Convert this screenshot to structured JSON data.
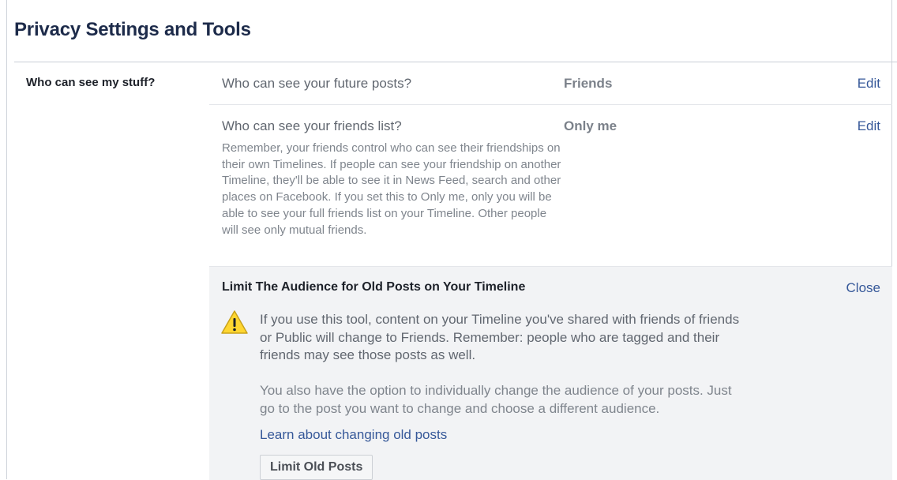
{
  "page": {
    "title": "Privacy Settings and Tools"
  },
  "section": {
    "label": "Who can see my stuff?"
  },
  "settings": [
    {
      "question": "Who can see your future posts?",
      "value": "Friends",
      "action": "Edit"
    },
    {
      "question": "Who can see your friends list?",
      "value": "Only me",
      "action": "Edit",
      "description": "Remember, your friends control who can see their friendships on their own Timelines. If people can see your friendship on another Timeline, they'll be able to see it in News Feed, search and other places on Facebook. If you set this to Only me, only you will be able to see your full friends list on your Timeline. Other people will see only mutual friends."
    }
  ],
  "limit_panel": {
    "title": "Limit The Audience for Old Posts on Your Timeline",
    "close_label": "Close",
    "warning_icon": "warning-triangle-icon",
    "warning_text": "If you use this tool, content on your Timeline you've shared with friends of friends or Public will change to Friends. Remember: people who are tagged and their friends may see those posts as well.",
    "option_text": "You also have the option to individually change the audience of your posts. Just go to the post you want to change and choose a different audience.",
    "learn_link": "Learn about changing old posts",
    "button_label": "Limit Old Posts"
  },
  "colors": {
    "link": "#365899",
    "panel_bg": "#f2f3f5",
    "warning_yellow": "#ffd630"
  }
}
